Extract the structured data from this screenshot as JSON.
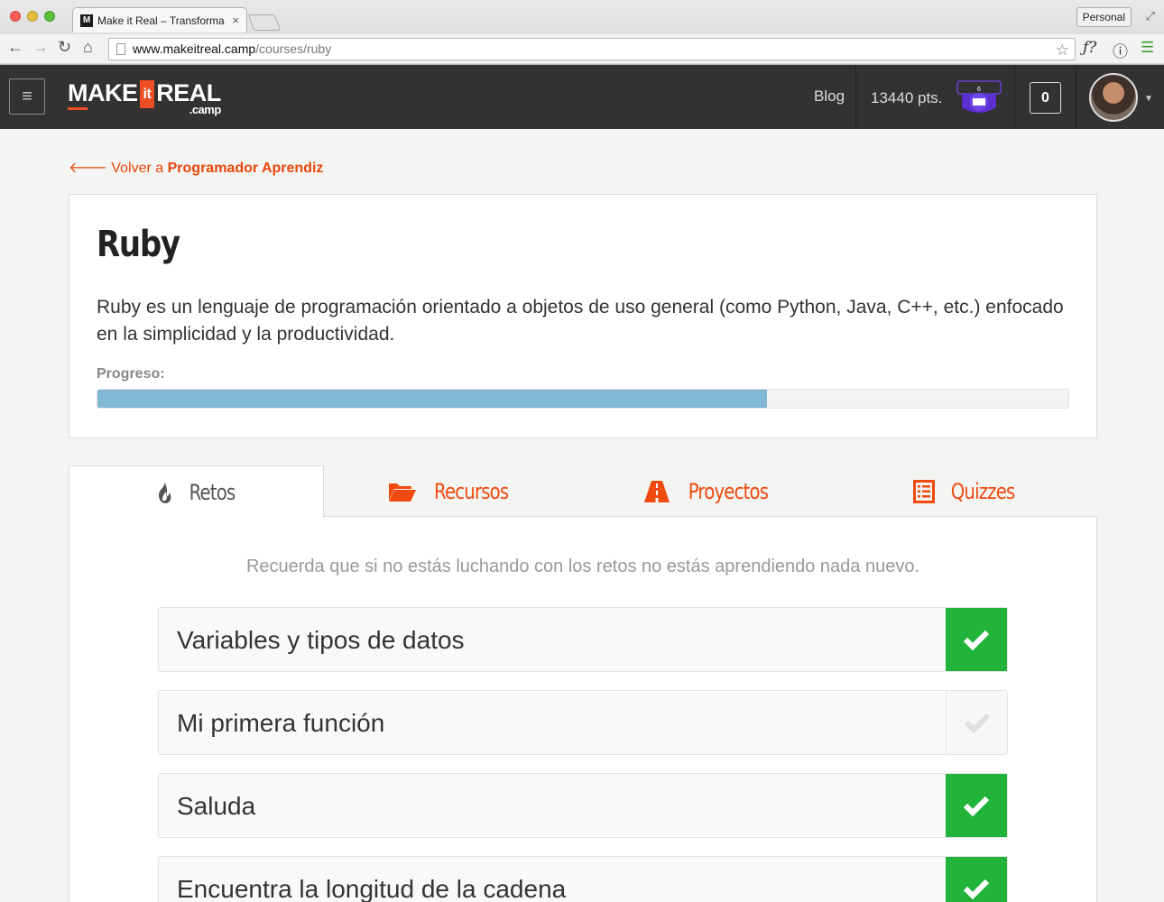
{
  "browser": {
    "tab_favicon": "M",
    "tab_title": "Make it Real – Transforma",
    "tab_close": "×",
    "profile": "Personal",
    "url_host": "www.makeitreal.camp",
    "url_path": "/courses/ruby",
    "ext_font": "ƒ?"
  },
  "header": {
    "logo_make": "MAKE",
    "logo_it": "it",
    "logo_real": "REAL",
    "logo_camp": ".camp",
    "blog": "Blog",
    "points": "13440 pts.",
    "badge_level": "6",
    "notifications": "0",
    "accent_color": "#f04f23"
  },
  "back": {
    "prefix": "Volver a",
    "target": "Programador Aprendiz"
  },
  "course": {
    "title": "Ruby",
    "description": "Ruby es un lenguaje de programación orientado a objetos de uso general (como Python, Java, C++, etc.) enfocado en la simplicidad y la productividad.",
    "progress_label": "Progreso:",
    "progress_fraction": 0.69,
    "progress_color": "#80b7d4"
  },
  "tabs": [
    {
      "label": "Retos",
      "icon": "fire-icon",
      "active": true
    },
    {
      "label": "Recursos",
      "icon": "folder-open-icon",
      "active": false
    },
    {
      "label": "Proyectos",
      "icon": "road-icon",
      "active": false
    },
    {
      "label": "Quizzes",
      "icon": "list-icon",
      "active": false
    }
  ],
  "challenges": {
    "note": "Recuerda que si no estás luchando con los retos no estás aprendiendo nada nuevo.",
    "items": [
      {
        "name": "Variables y tipos de datos",
        "completed": true
      },
      {
        "name": "Mi primera función",
        "completed": false
      },
      {
        "name": "Saluda",
        "completed": true
      },
      {
        "name": "Encuentra la longitud de la cadena",
        "completed": true
      }
    ]
  }
}
